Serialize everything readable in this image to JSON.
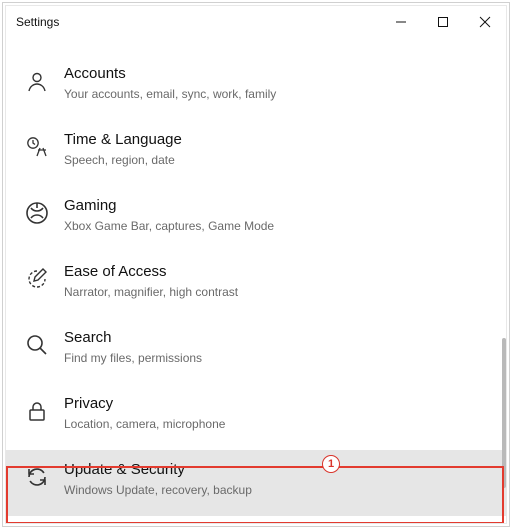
{
  "window": {
    "title": "Settings"
  },
  "items": [
    {
      "title": "Accounts",
      "sub": "Your accounts, email, sync, work, family"
    },
    {
      "title": "Time & Language",
      "sub": "Speech, region, date"
    },
    {
      "title": "Gaming",
      "sub": "Xbox Game Bar, captures, Game Mode"
    },
    {
      "title": "Ease of Access",
      "sub": "Narrator, magnifier, high contrast"
    },
    {
      "title": "Search",
      "sub": "Find my files, permissions"
    },
    {
      "title": "Privacy",
      "sub": "Location, camera, microphone"
    },
    {
      "title": "Update & Security",
      "sub": "Windows Update, recovery, backup"
    }
  ],
  "annotation": {
    "badge_label": "1",
    "highlight_index": 6
  },
  "colors": {
    "highlight_border": "#e33b2f",
    "selected_bg": "#e6e6e6",
    "sub_text": "#6a6a6a"
  }
}
